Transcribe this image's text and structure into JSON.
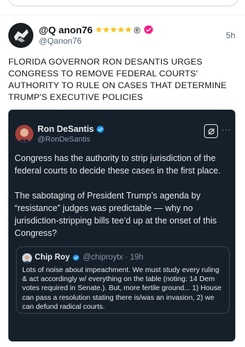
{
  "post": {
    "author_name": "@Q anon76",
    "author_stars": "★★★★★",
    "author_reg": "®",
    "author_handle": "@Qanon76",
    "time": "5h",
    "text": "FLORIDA GOVERNOR RON DESANTIS URGES CONGRESS TO REMOVE FEDERAL COURTS' AUTHORITY TO RULE ON CASES THAT DETERMINE TRUMP'S EXECUTIVE POLICIES"
  },
  "embedded": {
    "author_name": "Ron DeSantis",
    "author_handle": "@RonDeSantis",
    "more": "···",
    "paragraph1": "Congress has the authority to strip jurisdiction of the federal courts to decide these cases in the first place.",
    "paragraph2": "The sabotaging of President Trump’s agenda by “resistance” judges was predictable — why no jurisdiction-stripping bills tee’d up at the onset of this Congress?",
    "quote": {
      "author_name": "Chip Roy",
      "author_handle": "@chiproytx · 19h",
      "text": "Lots of noise about impeachment. We must study every ruling & act accordingly w/ everything on the table (noting: 14 Dem votes required in Senate.). But, more fertile ground... 1) House can pass a resolution stating there is/was an invasion, 2) we can defund radical courts."
    }
  },
  "colors": {
    "verified_pink": "#f91880",
    "verified_blue": "#1d9bf0",
    "stars": "#f4c21c",
    "embed_bg": "#15202b"
  },
  "icons": [
    "verified-badge-icon",
    "grok-icon",
    "more-icon",
    "avatar"
  ]
}
